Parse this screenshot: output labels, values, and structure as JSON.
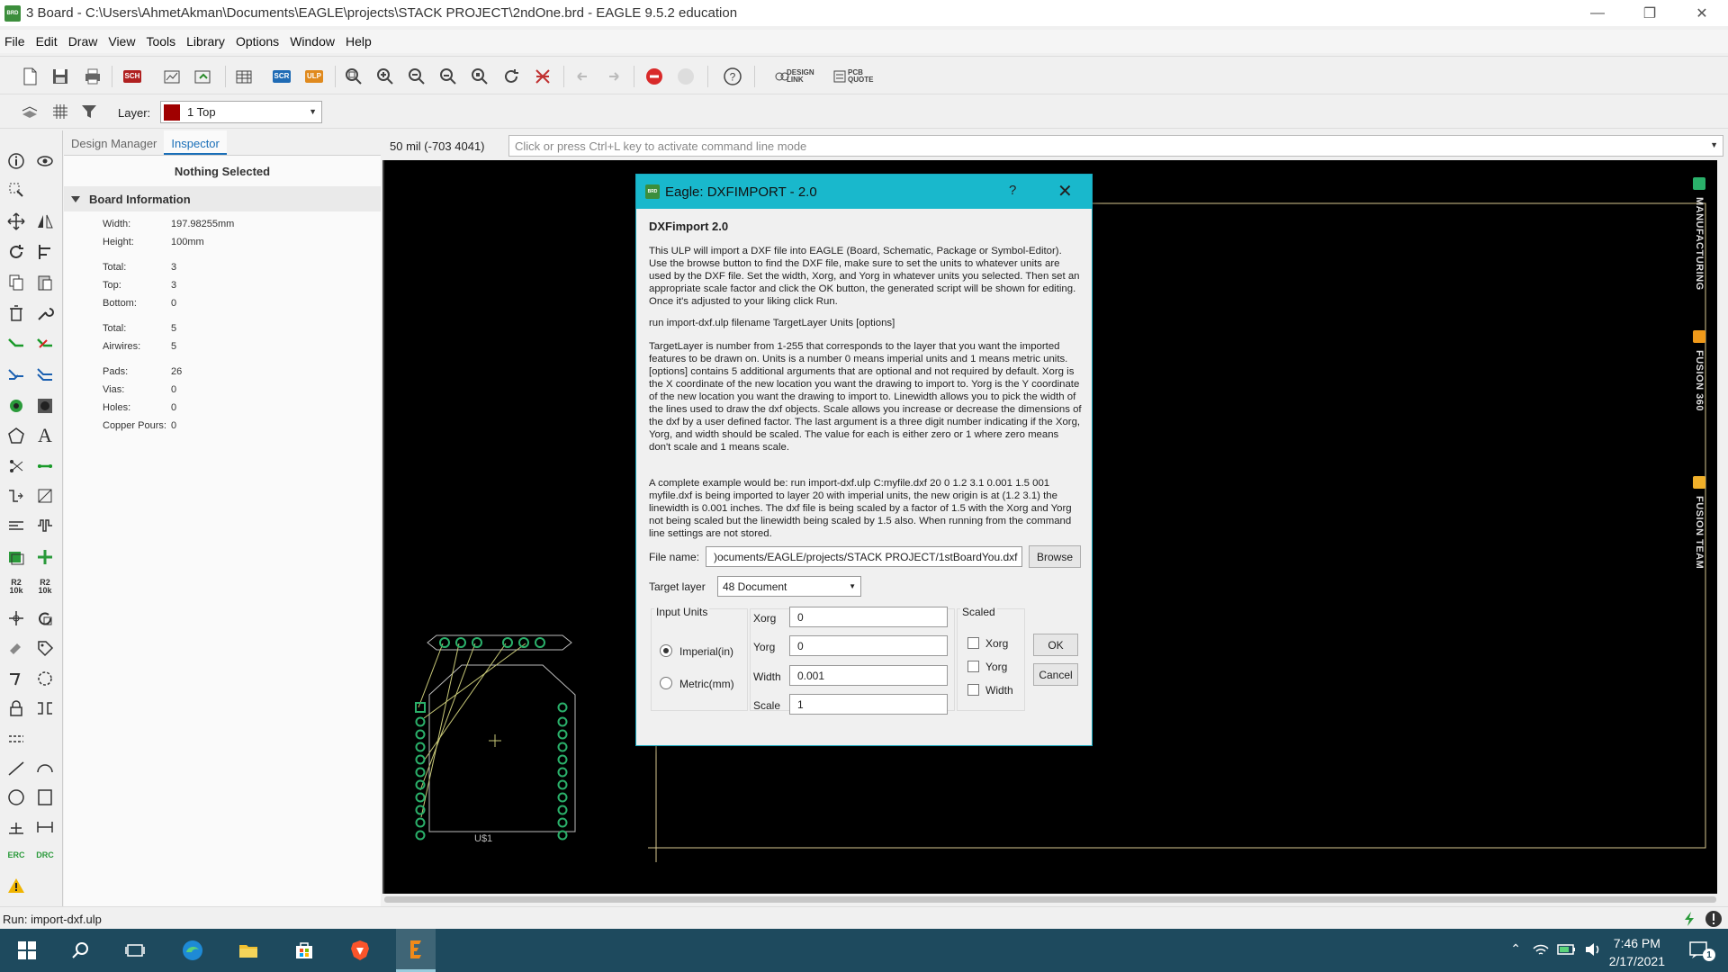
{
  "window": {
    "title": "3 Board - C:\\Users\\AhmetAkman\\Documents\\EAGLE\\projects\\STACK PROJECT\\2ndOne.brd - EAGLE 9.5.2 education",
    "app_icon": "BRD"
  },
  "menu": [
    "File",
    "Edit",
    "Draw",
    "View",
    "Tools",
    "Library",
    "Options",
    "Window",
    "Help"
  ],
  "toolbar": {
    "sch_label": "SCH",
    "scr_label": "SCR",
    "ulp_label": "ULP",
    "design_link": "DESIGN\nLINK",
    "pcb_quote": "PCB\nQUOTE"
  },
  "layerbar": {
    "label": "Layer:",
    "value": "1 Top",
    "color": "#a00000"
  },
  "palette": {
    "r2_label": "R2\n10k",
    "r2b_label": "R2\n10k",
    "erc": "ERC",
    "drc": "DRC"
  },
  "panel": {
    "tabs": [
      "Design Manager",
      "Inspector"
    ],
    "active_tab": "Inspector",
    "selection": "Nothing Selected",
    "section": "Board Information",
    "props": [
      {
        "k": "Width:",
        "v": "197.98255mm"
      },
      {
        "k": "Height:",
        "v": "100mm"
      },
      {
        "k": "Total:",
        "v": "3"
      },
      {
        "k": "Top:",
        "v": "3"
      },
      {
        "k": "Bottom:",
        "v": "0"
      },
      {
        "k": "Total:",
        "v": "5"
      },
      {
        "k": "Airwires:",
        "v": "5"
      },
      {
        "k": "Pads:",
        "v": "26"
      },
      {
        "k": "Vias:",
        "v": "0"
      },
      {
        "k": "Holes:",
        "v": "0"
      },
      {
        "k": "Copper Pours:",
        "v": "0"
      }
    ]
  },
  "coords": "50 mil (-703 4041)",
  "cmdline": {
    "placeholder": "Click or press Ctrl+L key to activate command line mode"
  },
  "canvas": {
    "part_label": "U$1"
  },
  "right_strip": [
    "MANUFACTURING",
    "FUSION 360",
    "FUSION TEAM"
  ],
  "dialog": {
    "title": "Eagle: DXFIMPORT - 2.0",
    "help": "?",
    "heading": "DXFimport 2.0",
    "para1": "This ULP will import a DXF file into EAGLE (Board, Schematic, Package or Symbol-Editor). Use the browse button to find the DXF file, make sure to set the units to whatever units are used by the DXF file. Set the width, Xorg, and Yorg in whatever units you selected. Then set an appropriate scale factor and click the OK button, the generated script will be shown for editing. Once it's adjusted to your liking click Run.",
    "para2": "run import-dxf.ulp filename TargetLayer Units [options]",
    "para3": "TargetLayer is number from 1-255 that corresponds to the layer that you want the imported features to be drawn on. Units is a number 0 means imperial units and 1 means metric units. [options] contains 5 additional arguments that are optional and not required by default. Xorg is the X coordinate of the new location you want the drawing to import to. Yorg is the Y coordinate of the new location you want the drawing to import to. Linewidth allows you to pick the width of the lines used to draw the dxf objects. Scale allows you increase or decrease the dimensions of the dxf by a user defined factor. The last argument is a three digit number indicating if the Xorg, Yorg, and width should be scaled. The value for each is either zero or 1 where zero means don't scale and 1 means scale.",
    "para4": "A complete example would be: run import-dxf.ulp C:myfile.dxf 20 0 1.2 3.1 0.001 1.5 001 myfile.dxf is being imported to layer 20 with imperial units, the new origin is at (1.2 3.1) the linewidth is 0.001 inches. The dxf file is being scaled by a factor of 1.5 with the Xorg and Yorg not being scaled but the linewidth being scaled by 1.5 also. When running from the command line settings are not stored.",
    "file_label": "File name:",
    "file_value": ")ocuments/EAGLE/projects/STACK PROJECT/1stBoardYou.dxf",
    "browse": "Browse",
    "target_label": "Target layer",
    "target_value": "48 Document",
    "input_units": "Input Units",
    "imperial": "Imperial(in)",
    "metric": "Metric(mm)",
    "xorg_label": "Xorg",
    "xorg_value": "0",
    "yorg_label": "Yorg",
    "yorg_value": "0",
    "width_label": "Width",
    "width_value": "0.001",
    "scale_label": "Scale",
    "scale_value": "1",
    "scaled": "Scaled",
    "scaled_xorg": "Xorg",
    "scaled_yorg": "Yorg",
    "scaled_width": "Width",
    "ok": "OK",
    "cancel": "Cancel"
  },
  "status": "Run: import-dxf.ulp",
  "taskbar": {
    "time": "7:46 PM",
    "date": "2/17/2021",
    "notif_count": "1"
  }
}
